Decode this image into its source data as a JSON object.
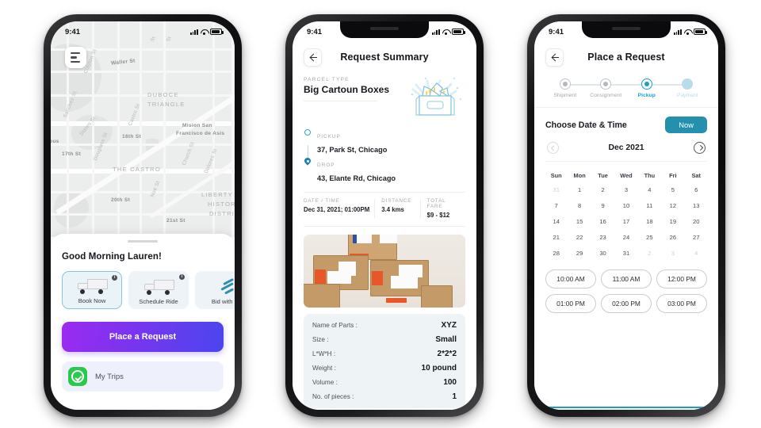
{
  "status_bar": {
    "time": "9:41",
    "icons": [
      "signal-icon",
      "wifi-icon",
      "battery-icon"
    ]
  },
  "phone1": {
    "name": "home-map-screen",
    "menu_icon": "hamburger-menu-icon",
    "greeting": "Good Morning Lauren!",
    "service_cards": [
      {
        "label": "Book Now",
        "icon": "truck-icon",
        "badge": "i",
        "active": true
      },
      {
        "label": "Schedule Ride",
        "icon": "truck-icon",
        "badge": "i",
        "active": false
      },
      {
        "label": "Bid with D",
        "icon": "bid-icon",
        "badge": "",
        "active": false
      }
    ],
    "cta_label": "Place a Request",
    "trips_label": "My Trips",
    "trips_icon": "green-check-icon",
    "map_labels": [
      "Waller St",
      "DUBOCE",
      "TRIANGLE",
      "Castro St",
      "16th St",
      "States St",
      "Mision San",
      "Francisco de Asis",
      "Dolores St",
      "17th St",
      "Douglass St",
      "THE CASTRO",
      "Church St",
      "LIBERTY S",
      "HISTOR",
      "DISTRI",
      "20th St",
      "Noe St",
      "21st St",
      "ous",
      "Clayton St",
      "Sanchez St",
      "St",
      "St"
    ],
    "accent_gradient": [
      "#9b2bf0",
      "#4a46ee"
    ],
    "trips_accent": "#27ca4a"
  },
  "phone2": {
    "name": "request-summary-screen",
    "title": "Request Summary",
    "back_icon": "back-arrow-icon",
    "parcel_caption": "PARCEL TYPE",
    "parcel_type": "Big Cartoun Boxes",
    "illustration": "open-box-illustration",
    "stops": [
      {
        "caption": "PICKUP",
        "address": "37, Park St, Chicago",
        "icon": "circle-outline-icon"
      },
      {
        "caption": "DROP",
        "address": "43, Elante Rd, Chicago",
        "icon": "map-pin-icon"
      }
    ],
    "metrics": [
      {
        "caption": "DATE / TIME",
        "value": "Dec 31, 2021; 01:00PM"
      },
      {
        "caption": "DISTANCE",
        "value": "3.4 kms"
      },
      {
        "caption": "TOTAL FARE",
        "value": "$9 - $12"
      }
    ],
    "photo": "cardboard-boxes-photo",
    "specs": [
      {
        "key": "Name of Parts :",
        "value": "XYZ"
      },
      {
        "key": "Size :",
        "value": "Small"
      },
      {
        "key": "L*W*H :",
        "value": "2*2*2"
      },
      {
        "key": "Weight :",
        "value": "10 pound"
      },
      {
        "key": "Volume :",
        "value": "100"
      },
      {
        "key": "No. of pieces :",
        "value": "1"
      }
    ]
  },
  "phone3": {
    "name": "place-a-request-screen",
    "title": "Place a Request",
    "back_icon": "back-arrow-icon",
    "steps": [
      {
        "label": "Shipment",
        "state": "done"
      },
      {
        "label": "Consignment",
        "state": "done"
      },
      {
        "label": "Pickup",
        "state": "active"
      },
      {
        "label": "Payment",
        "state": "future"
      }
    ],
    "section_title": "Choose Date & Time",
    "now_label": "Now",
    "month": "Dec 2021",
    "prev_icon": "chevron-left-icon",
    "next_icon": "chevron-right-icon",
    "weekdays": [
      "Sun",
      "Mon",
      "Tue",
      "Wed",
      "Thu",
      "Fri",
      "Sat"
    ],
    "weeks": [
      [
        {
          "d": "31",
          "muted": true
        },
        {
          "d": "1"
        },
        {
          "d": "2"
        },
        {
          "d": "3"
        },
        {
          "d": "4"
        },
        {
          "d": "5"
        },
        {
          "d": "6"
        }
      ],
      [
        {
          "d": "7"
        },
        {
          "d": "8"
        },
        {
          "d": "9"
        },
        {
          "d": "10"
        },
        {
          "d": "11"
        },
        {
          "d": "12"
        },
        {
          "d": "13"
        }
      ],
      [
        {
          "d": "14"
        },
        {
          "d": "15"
        },
        {
          "d": "16"
        },
        {
          "d": "17"
        },
        {
          "d": "18"
        },
        {
          "d": "19"
        },
        {
          "d": "20"
        }
      ],
      [
        {
          "d": "21"
        },
        {
          "d": "22"
        },
        {
          "d": "23"
        },
        {
          "d": "24"
        },
        {
          "d": "25"
        },
        {
          "d": "26"
        },
        {
          "d": "27"
        }
      ],
      [
        {
          "d": "28"
        },
        {
          "d": "29"
        },
        {
          "d": "30"
        },
        {
          "d": "31"
        },
        {
          "d": "2",
          "muted": true
        },
        {
          "d": "3",
          "muted": true
        },
        {
          "d": "4",
          "muted": true
        }
      ]
    ],
    "time_slots": [
      [
        "10:00 AM",
        "11:00 AM",
        "12:00 PM"
      ],
      [
        "01:00 PM",
        "02:00 PM",
        "03:00 PM"
      ]
    ],
    "accent": "#2490ad"
  }
}
